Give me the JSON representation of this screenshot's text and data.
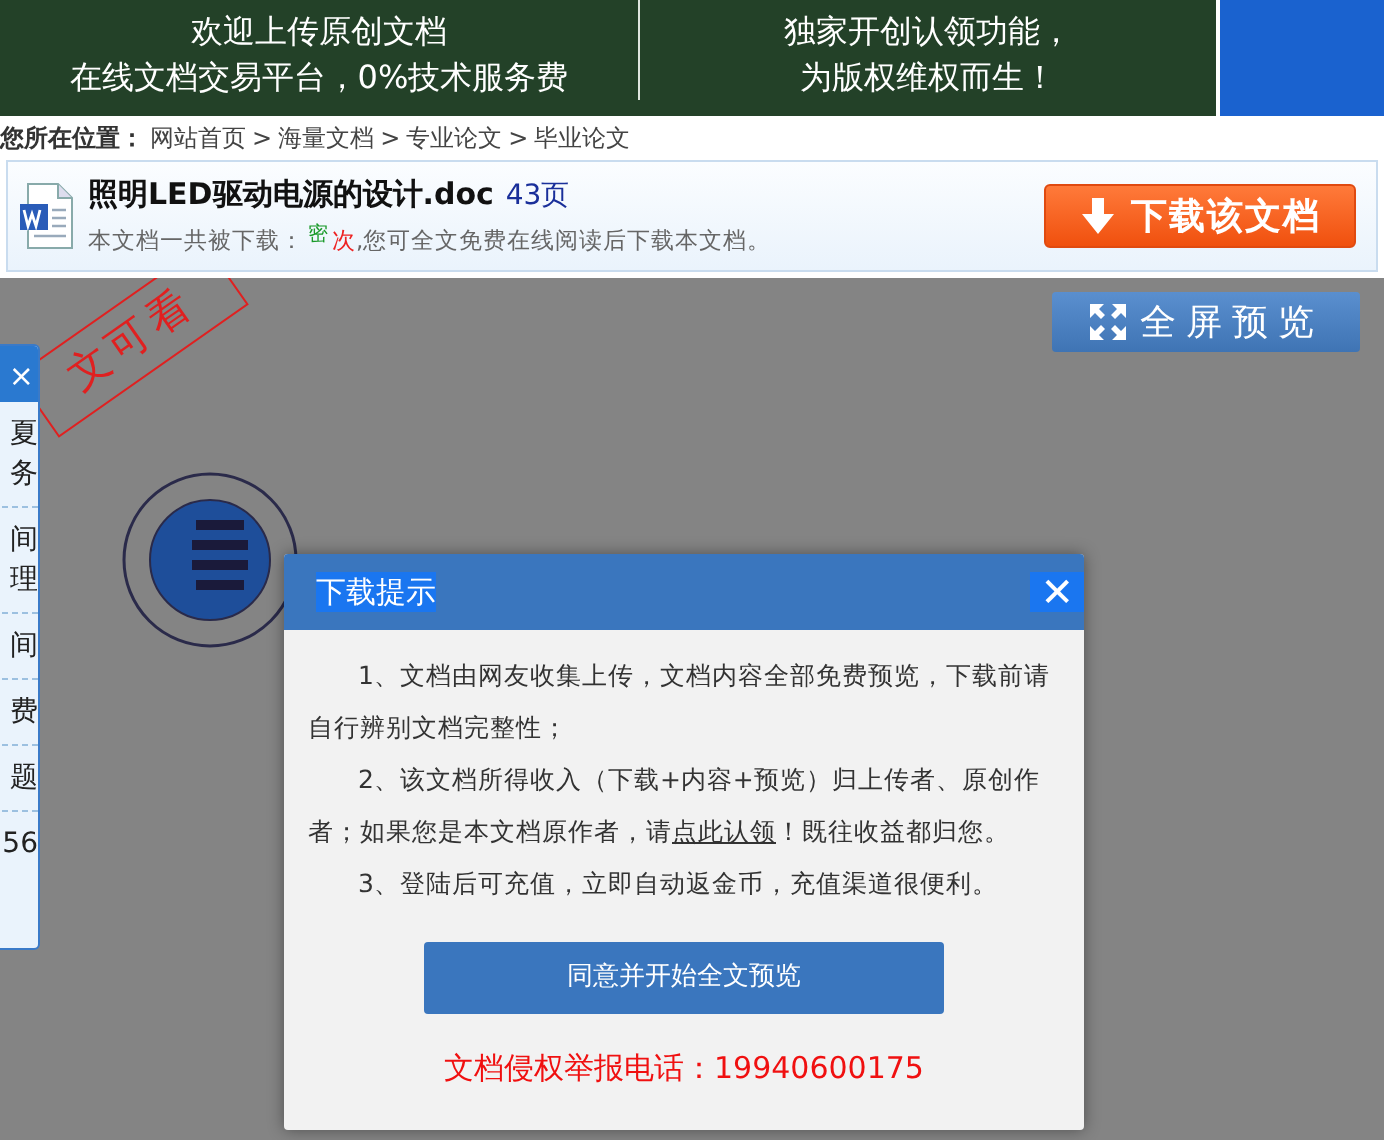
{
  "banner": {
    "columns": [
      {
        "lines": [
          "欢迎上传原创文档",
          "在线文档交易平台，0%技术服务费"
        ]
      },
      {
        "lines": [
          "独家开创认领功能，",
          "为版权维权而生！"
        ]
      }
    ]
  },
  "breadcrumb": {
    "label": "您所在位置：",
    "items": [
      "网站首页",
      "海量文档",
      "专业论文",
      "毕业论文"
    ],
    "separators": [
      ">",
      ">",
      ">"
    ]
  },
  "document": {
    "title": "照明LED驱动电源的设计.doc",
    "pages": "43页",
    "info_prefix": "本文档一共被下载：",
    "count": "密",
    "count_unit": "次",
    "info_suffix": ",您可全文免费在线阅读后下载本文档。"
  },
  "download_button": "下载该文档",
  "fullscreen_button": "全屏预览",
  "stamp": "文可看",
  "side_panel": {
    "close": "×",
    "items": [
      {
        "lines": [
          "夏",
          "务"
        ]
      },
      {
        "lines": [
          "间",
          "理"
        ]
      },
      {
        "lines": [
          "间"
        ]
      },
      {
        "lines": [
          "费"
        ]
      },
      {
        "lines": [
          "题"
        ]
      },
      {
        "lines": [
          "56"
        ]
      }
    ]
  },
  "dialog": {
    "title": "下载提示",
    "close": "✕",
    "paragraphs": [
      {
        "text": "1、文档由网友收集上传，文档内容全部免费预览，下载前请自行辨别文档完整性；"
      },
      {
        "text": "2、该文档所得收入（下载+内容+预览）归上传者、原创作者；如果您是本文档原作者，请",
        "link": "点此认领",
        "after": "！既往收益都归您。"
      },
      {
        "text": "3、登陆后可充值，立即自动返金币，充值渠道很便利。"
      }
    ],
    "button": "同意并开始全文预览",
    "hotline": "文档侵权举报电话：19940600175"
  }
}
